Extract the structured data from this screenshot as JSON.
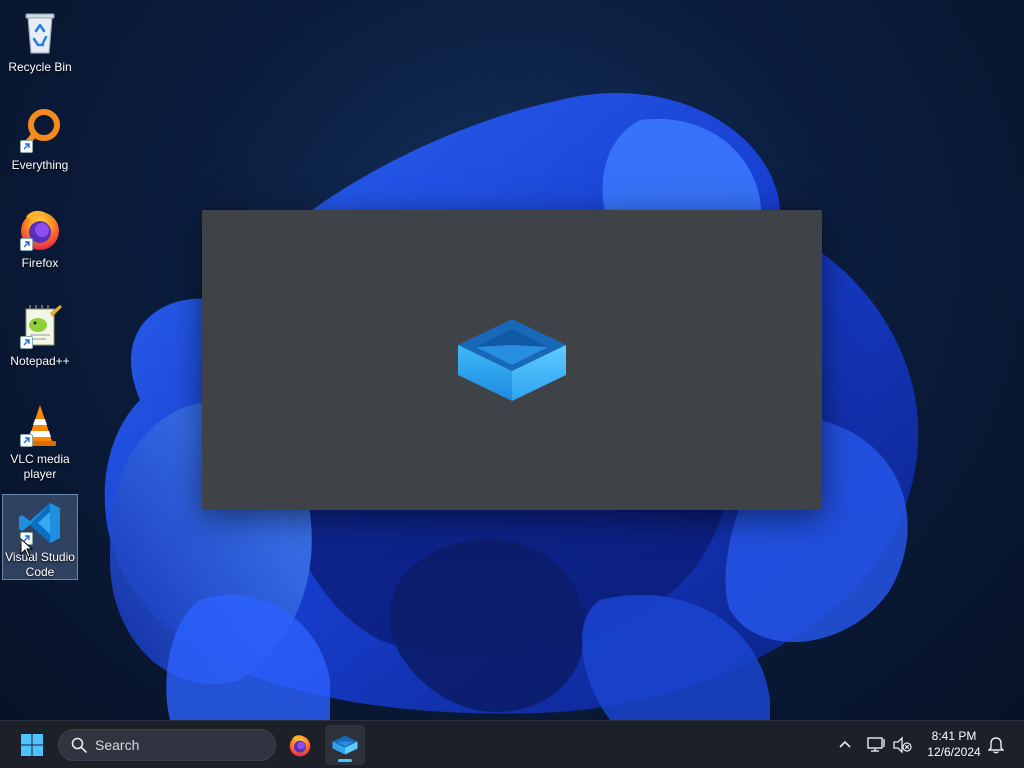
{
  "desktop": {
    "icons": [
      {
        "label": "Recycle Bin",
        "icon": "recycle-bin-icon"
      },
      {
        "label": "Everything",
        "icon": "everything-search-icon"
      },
      {
        "label": "Firefox",
        "icon": "firefox-icon"
      },
      {
        "label": "Notepad++",
        "icon": "notepad-plus-plus-icon"
      },
      {
        "label": "VLC media player",
        "icon": "vlc-cone-icon"
      },
      {
        "label": "Visual Studio Code",
        "icon": "vscode-icon",
        "selected": true
      }
    ]
  },
  "splash": {
    "icon": "sandbox-box-icon"
  },
  "taskbar": {
    "search_placeholder": "Search",
    "pinned": [
      {
        "icon": "firefox-icon"
      },
      {
        "icon": "sandbox-box-icon",
        "active": true
      }
    ],
    "clock": {
      "time": "8:41 PM",
      "date": "12/6/2024"
    }
  },
  "colors": {
    "taskbar_bg": "#1c2029",
    "splash_bg": "#3f4246",
    "accent": "#4cc2ff"
  }
}
